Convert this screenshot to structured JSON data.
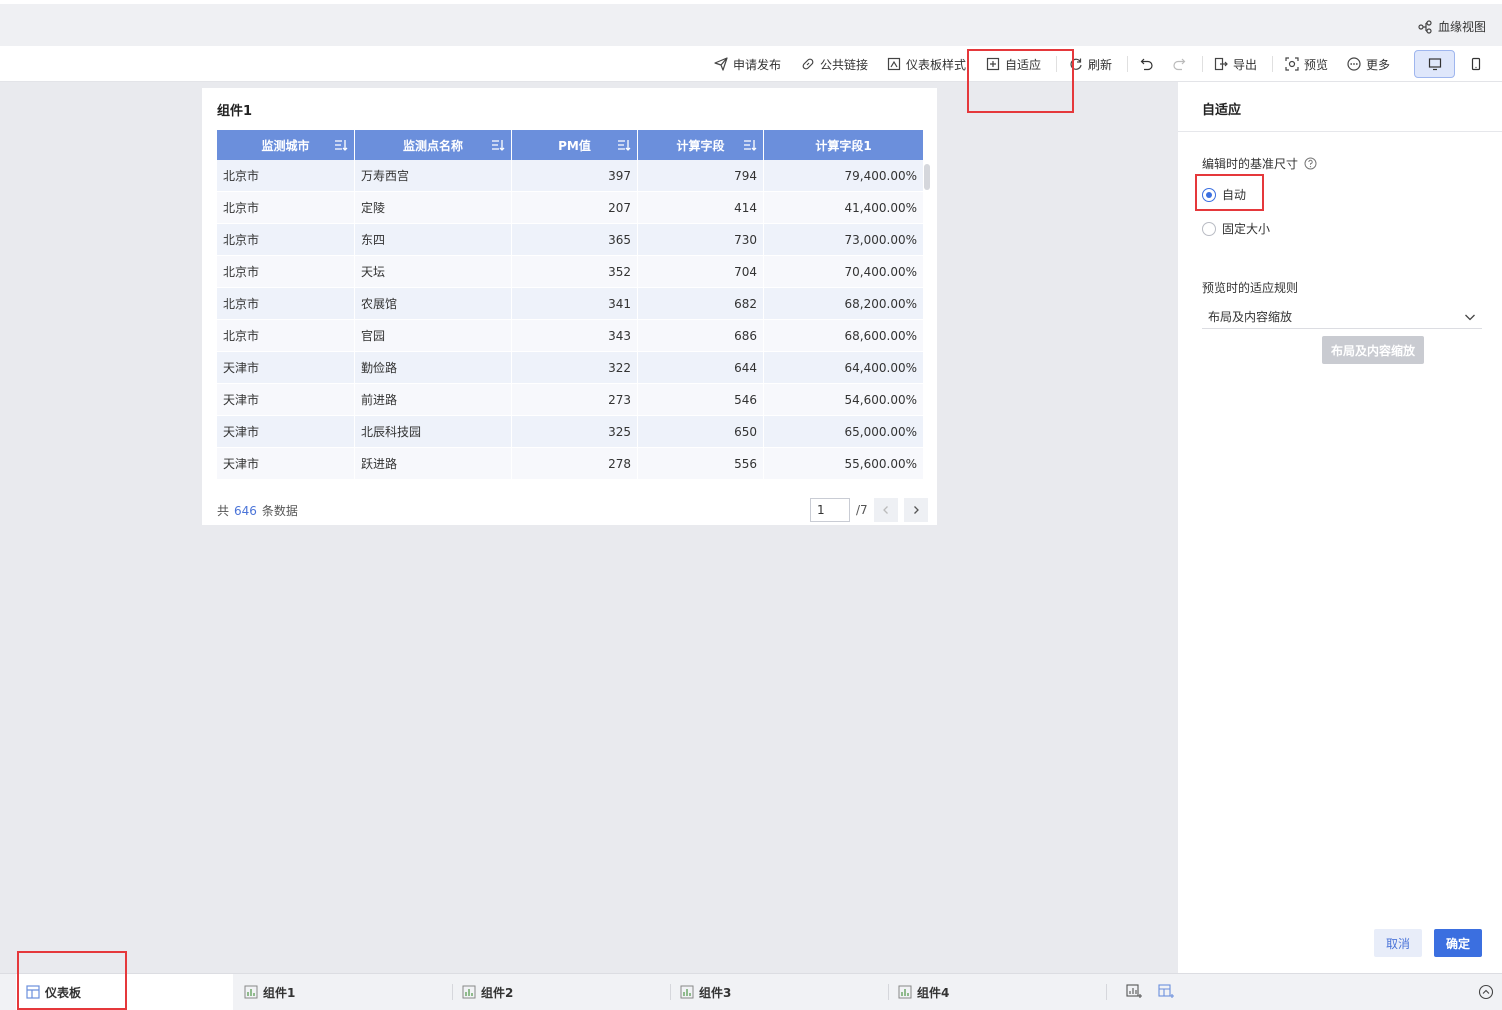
{
  "header": {
    "lineage_label": "血缘视图"
  },
  "toolbar": {
    "publish": "申请发布",
    "public_link": "公共链接",
    "dashboard_style": "仪表板样式",
    "adaptive": "自适应",
    "refresh": "刷新",
    "export": "导出",
    "preview": "预览",
    "more": "更多"
  },
  "card": {
    "title": "组件1",
    "columns": [
      "监测城市",
      "监测点名称",
      "PM值",
      "计算字段",
      "计算字段1"
    ],
    "rows": [
      [
        "北京市",
        "万寿西宫",
        "397",
        "794",
        "79,400.00%"
      ],
      [
        "北京市",
        "定陵",
        "207",
        "414",
        "41,400.00%"
      ],
      [
        "北京市",
        "东四",
        "365",
        "730",
        "73,000.00%"
      ],
      [
        "北京市",
        "天坛",
        "352",
        "704",
        "70,400.00%"
      ],
      [
        "北京市",
        "农展馆",
        "341",
        "682",
        "68,200.00%"
      ],
      [
        "北京市",
        "官园",
        "343",
        "686",
        "68,600.00%"
      ],
      [
        "天津市",
        "勤俭路",
        "322",
        "644",
        "64,400.00%"
      ],
      [
        "天津市",
        "前进路",
        "273",
        "546",
        "54,600.00%"
      ],
      [
        "天津市",
        "北辰科技园",
        "325",
        "650",
        "65,000.00%"
      ],
      [
        "天津市",
        "跃进路",
        "278",
        "556",
        "55,600.00%"
      ]
    ],
    "total_prefix": "共",
    "total_count": "646",
    "total_suffix": "条数据",
    "page_value": "1",
    "page_total": "/7"
  },
  "panel": {
    "title": "自适应",
    "base_size_label": "编辑时的基准尺寸",
    "option_auto": "自动",
    "option_fixed": "固定大小",
    "preview_rule_label": "预览时的适应规则",
    "preview_rule_value": "布局及内容缩放",
    "preview_rule_button": "布局及内容缩放",
    "cancel": "取消",
    "confirm": "确定"
  },
  "bottom_tabs": [
    "仪表板",
    "组件1",
    "组件2",
    "组件3",
    "组件4"
  ],
  "colors": {
    "header_blue": "#6b8fdc",
    "primary": "#3b6fe0",
    "highlight_red": "#e5383b"
  }
}
